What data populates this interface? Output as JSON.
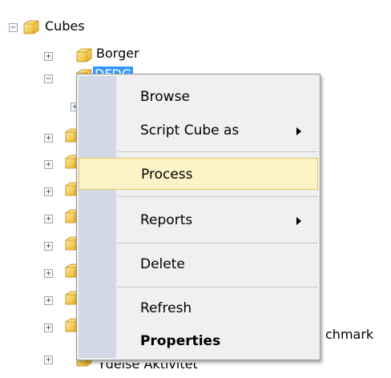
{
  "tree": {
    "root": {
      "label": "Cubes",
      "expander": "⊟"
    },
    "items": [
      {
        "label": "Borger",
        "expander": "+"
      },
      {
        "label": "DFDG",
        "expander": "−"
      },
      {
        "label": "",
        "expander": "+"
      },
      {
        "label": "",
        "expander": "+"
      },
      {
        "label": "",
        "expander": "+"
      },
      {
        "label": "",
        "expander": "+"
      },
      {
        "label": "",
        "expander": "+"
      },
      {
        "label": "",
        "expander": "+"
      },
      {
        "label": "",
        "expander": "+"
      },
      {
        "label": "",
        "expander": "+"
      },
      {
        "label": "chmark",
        "expander": "+"
      },
      {
        "label": "Ydelse Aktivitet",
        "expander": "+"
      }
    ]
  },
  "context_menu": {
    "items": [
      {
        "label": "Browse"
      },
      {
        "label": "Script Cube as",
        "submenu": true
      },
      {
        "label": "Process",
        "highlighted": true
      },
      {
        "label": "Reports",
        "submenu": true
      },
      {
        "label": "Delete"
      },
      {
        "label": "Refresh"
      },
      {
        "label": "Properties",
        "bold": true
      }
    ]
  },
  "colors": {
    "selection": "#3399ff",
    "menu_highlight": "#fcf3c7",
    "menu_gutter": "#d2d8e6",
    "folder": "#f5c227"
  }
}
